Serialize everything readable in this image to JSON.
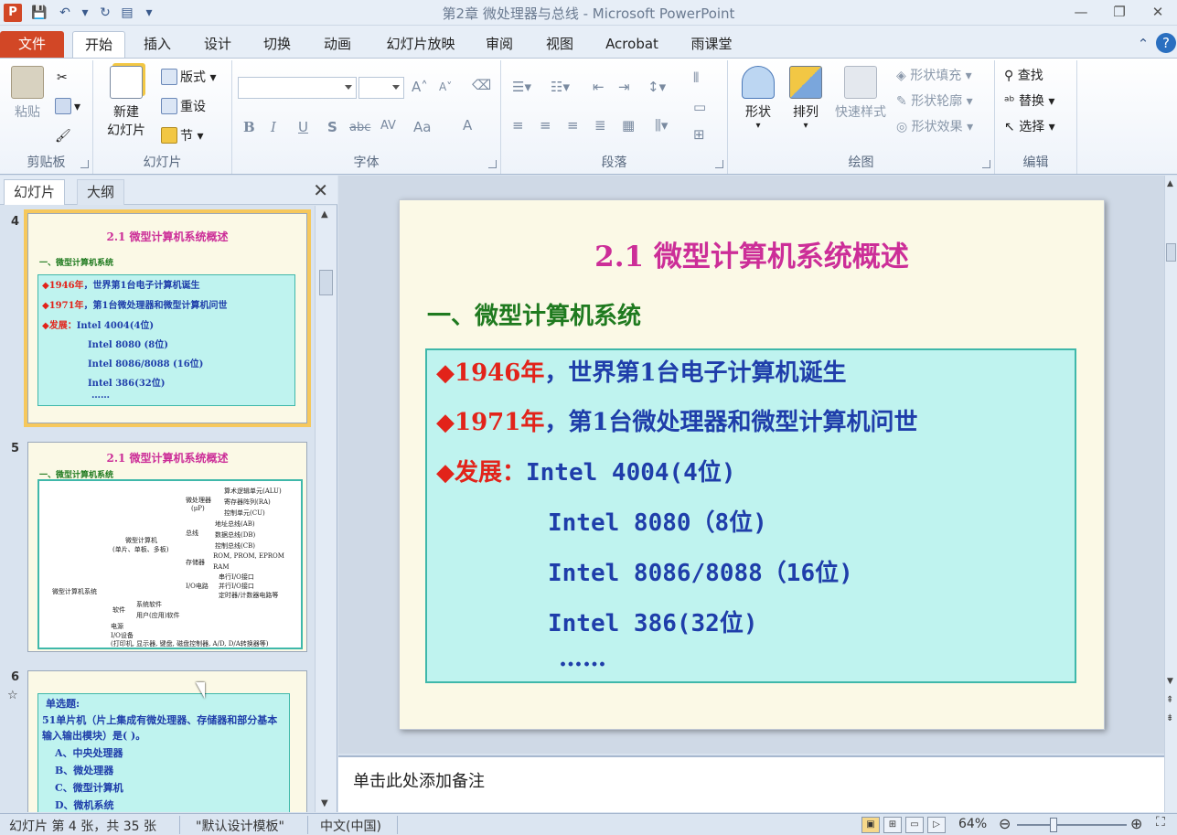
{
  "window": {
    "title": "第2章 微处理器与总线 - Microsoft PowerPoint",
    "app_icon": "P",
    "qat": {
      "save_icon": "save-icon",
      "undo_icon": "undo-icon",
      "redo_icon": "redo-icon"
    }
  },
  "tabs": [
    "文件",
    "开始",
    "插入",
    "设计",
    "切换",
    "动画",
    "幻灯片放映",
    "审阅",
    "视图",
    "Acrobat",
    "雨课堂"
  ],
  "ribbon": {
    "clipboard": {
      "label": "剪贴板",
      "paste": "粘贴"
    },
    "slides": {
      "label": "幻灯片",
      "new_slide_1": "新建",
      "new_slide_2": "幻灯片",
      "layout": "版式",
      "reset": "重设",
      "section": "节"
    },
    "font": {
      "label": "字体",
      "bold": "B",
      "italic": "I",
      "underline": "U",
      "shadow": "S",
      "strike": "abc",
      "spacing": "AV",
      "case": "Aa",
      "color": "A"
    },
    "paragraph": {
      "label": "段落"
    },
    "drawing": {
      "label": "绘图",
      "shapes": "形状",
      "arrange": "排列",
      "quick_styles": "快速样式",
      "fill": "形状填充",
      "outline": "形状轮廓",
      "effects": "形状效果"
    },
    "editing": {
      "label": "编辑",
      "find": "查找",
      "replace": "替换",
      "select": "选择"
    }
  },
  "left_pane": {
    "tab_slides": "幻灯片",
    "tab_outline": "大纲",
    "close": "✕",
    "thumbs": [
      {
        "num": "4",
        "title": "2.1 微型计算机系统概述",
        "sub": "一、微型计算机系统",
        "lines": [
          {
            "red": "◆1946年",
            "blue": "，世界第1台电子计算机诞生"
          },
          {
            "red": "◆1971年",
            "blue": "，第1台微处理器和微型计算机问世"
          },
          {
            "red": "◆发展：",
            "blue": "Intel 4004(4位)"
          },
          {
            "red": "",
            "blue": "Intel 8080 (8位)"
          },
          {
            "red": "",
            "blue": "Intel 8086/8088 (16位)"
          },
          {
            "red": "",
            "blue": "Intel 386(32位)"
          },
          {
            "red": "",
            "blue": "……"
          }
        ]
      },
      {
        "num": "5",
        "title": "2.1 微型计算机系统概述",
        "sub": "一、微型计算机系统",
        "tree": {
          "root": "微型计算机系统",
          "micro": "微型计算机",
          "micro_sub": "(单片、单板、多板)",
          "cpu": "微处理器",
          "cpu_sub": "(μP)",
          "alu": "算术逻辑单元(ALU)",
          "regs": "寄存器阵列(RA)",
          "cu": "控制单元(CU)",
          "bus": "总线",
          "ab": "地址总线(AB)",
          "db": "数据总线(DB)",
          "cb": "控制总线(CB)",
          "mem": "存储器",
          "rom": "ROM, PROM, EPROM",
          "ram": "RAM",
          "io": "I/O电路",
          "serial": "串行I/O接口",
          "parallel": "并行I/O接口",
          "timer": "定时器/计数器电路等",
          "software": "软件",
          "sys_sw": "系统软件",
          "app_sw": "用户(应用)软件",
          "power": "电源",
          "iodev": "I/O设备",
          "iodev_sub": "(打印机, 显示器, 键盘, 磁盘控制器, A/D, D/A转换器等)"
        }
      },
      {
        "num": "6",
        "star": "☆",
        "title": "单选题:",
        "question": "51单片机（片上集成有微处理器、存储器和部分基本输入输出模块）是(        )。",
        "options": [
          "A、中央处理器",
          "B、微处理器",
          "C、微型计算机",
          "D、微机系统"
        ]
      }
    ]
  },
  "slide": {
    "title": "2.1 微型计算机系统概述",
    "subtitle": "一、微型计算机系统",
    "lines": [
      {
        "red": "◆1946年",
        "blue": "，世界第1台电子计算机诞生"
      },
      {
        "red": "◆1971年",
        "blue": "，第1台微处理器和微型计算机问世"
      },
      {
        "red": "◆发展：",
        "blue": "Intel 4004(4位)"
      },
      {
        "red": "",
        "blue": "Intel 8080（8位)"
      },
      {
        "red": "",
        "blue": "Intel 8086/8088（16位)"
      },
      {
        "red": "",
        "blue": "Intel 386(32位)"
      },
      {
        "red": "",
        "blue": "……"
      }
    ]
  },
  "notes": {
    "placeholder": "单击此处添加备注"
  },
  "status": {
    "slide_info": "幻灯片 第 4 张，共 35 张",
    "theme": "\"默认设计模板\"",
    "lang": "中文(中国)",
    "zoom": "64%",
    "zoom_fraction": 0.64
  },
  "colors": {
    "accent": "#d24726",
    "title_pink": "#cc2e98",
    "subtitle_green": "#1f7a1f",
    "text_blue": "#1f3eaa",
    "bullet_red": "#e2231a",
    "box_fill": "#bff3ef"
  }
}
